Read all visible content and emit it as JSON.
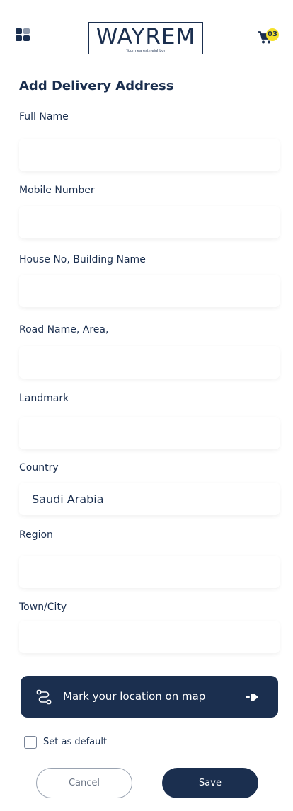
{
  "header": {
    "logo_text": "WAYREM",
    "logo_tagline": "Your nearest neighbor",
    "cart_count": "03"
  },
  "page_title": "Add Delivery Address",
  "form": {
    "full_name": {
      "label": "Full Name",
      "value": "",
      "placeholder": ""
    },
    "mobile": {
      "label": "Mobile Number",
      "value": "",
      "placeholder": ""
    },
    "house": {
      "label": "House No, Building Name",
      "value": "",
      "placeholder": ""
    },
    "road": {
      "label": "Road Name, Area,",
      "value": "",
      "placeholder": ""
    },
    "landmark": {
      "label": "Landmark",
      "value": "",
      "placeholder": ""
    },
    "country": {
      "label": "Country",
      "value": "Saudi Arabia",
      "placeholder": ""
    },
    "region": {
      "label": "Region",
      "value": "",
      "placeholder": ""
    },
    "town": {
      "label": "Town/City",
      "value": "",
      "placeholder": ""
    }
  },
  "map_button": {
    "label": "Mark your location on map"
  },
  "default_checkbox": {
    "label": "Set as default",
    "checked": false
  },
  "actions": {
    "cancel_label": "Cancel",
    "save_label": "Save"
  },
  "colors": {
    "primary": "#1b2f4f",
    "badge": "#f5e12a",
    "muted": "#8e99ab"
  }
}
